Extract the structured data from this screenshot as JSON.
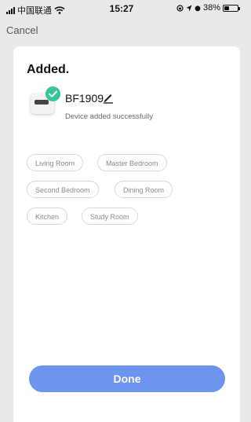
{
  "status_bar": {
    "carrier": "中国联通",
    "time": "15:27",
    "battery": "38%",
    "battery_level": 0.38
  },
  "nav": {
    "cancel_label": "Cancel"
  },
  "card": {
    "title": "Added.",
    "device": {
      "name": "BF1909",
      "status": "Device added successfully",
      "badge_color": "#36c69a"
    },
    "rooms": [
      "Living Room",
      "Master Bedroom",
      "Second Bedroom",
      "Dining Room",
      "Kitchen",
      "Study Room"
    ],
    "done_label": "Done",
    "accent_color": "#6d94ef"
  }
}
